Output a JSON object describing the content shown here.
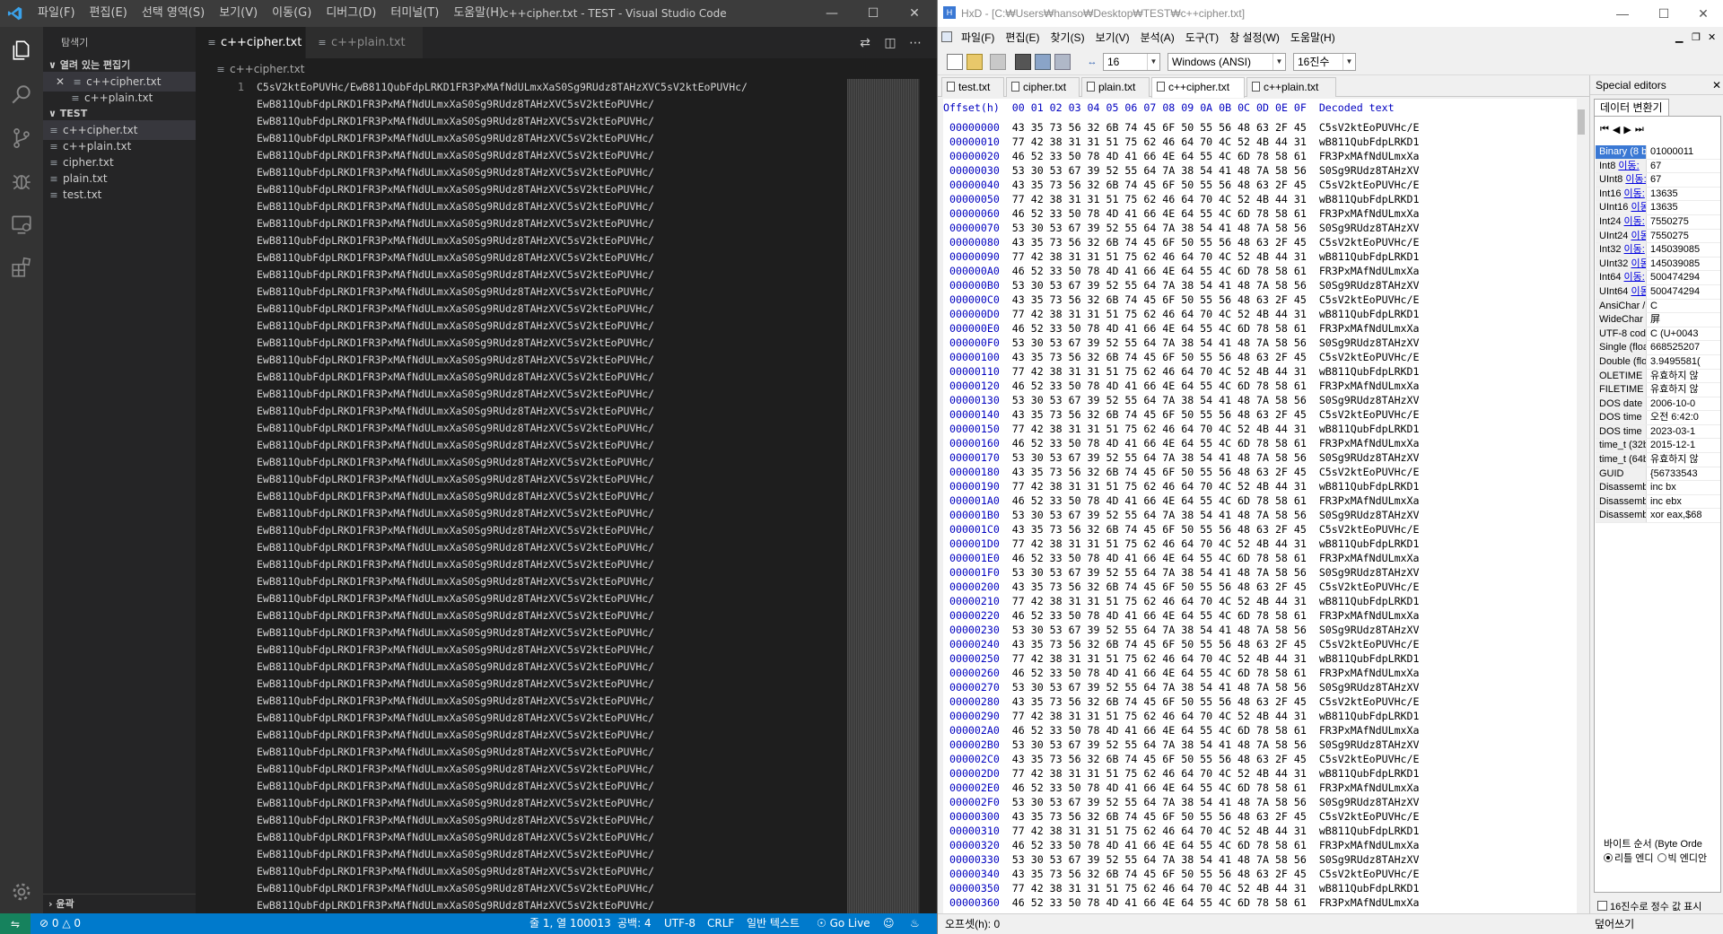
{
  "vscode": {
    "menu": [
      "파일(F)",
      "편집(E)",
      "선택 영역(S)",
      "보기(V)",
      "이동(G)",
      "디버그(D)",
      "터미널(T)",
      "도움말(H)"
    ],
    "window_title": "c++cipher.txt - TEST - Visual Studio Code",
    "sidebar": {
      "title": "탐색기",
      "open_editors_label": "열려 있는 편집기",
      "open_editors": [
        "c++cipher.txt",
        "c++plain.txt"
      ],
      "folder_label": "TEST",
      "files": [
        "c++cipher.txt",
        "c++plain.txt",
        "cipher.txt",
        "plain.txt",
        "test.txt"
      ],
      "outline_label": "윤곽"
    },
    "tabs": [
      {
        "label": "c++cipher.txt",
        "active": true
      },
      {
        "label": "c++plain.txt",
        "active": false
      }
    ],
    "breadcrumb": "c++cipher.txt",
    "editor": {
      "line_number": "1",
      "first_line": "C5sV2ktEoPUVHc/EwB811QubFdpLRKD1FR3PxMAfNdULmxXaS0Sg9RUdz8TAHzXVC5sV2ktEoPUVHc/",
      "wrap_line": "EwB811QubFdpLRKD1FR3PxMAfNdULmxXaS0Sg9RUdz8TAHzXVC5sV2ktEoPUVHc/"
    },
    "status": {
      "errors": "0",
      "warnings": "0",
      "position": "줄 1, 열 100013",
      "spaces": "공백: 4",
      "encoding": "UTF-8",
      "eol": "CRLF",
      "language": "일반 텍스트",
      "golive": "Go Live"
    }
  },
  "hxd": {
    "title": "HxD - [C:₩Users₩hanso₩Desktop₩TEST₩c++cipher.txt]",
    "menu": [
      "파일(F)",
      "편집(E)",
      "찾기(S)",
      "보기(V)",
      "분석(A)",
      "도구(T)",
      "창 설정(W)",
      "도움말(H)"
    ],
    "toolbar": {
      "bytes_per_row": "16",
      "charset": "Windows (ANSI)",
      "base": "16진수"
    },
    "tabs": [
      "test.txt",
      "cipher.txt",
      "plain.txt",
      "c++cipher.txt",
      "c++plain.txt"
    ],
    "active_tab": "c++cipher.txt",
    "header": {
      "offset": "Offset(h)",
      "columns": [
        "00",
        "01",
        "02",
        "03",
        "04",
        "05",
        "06",
        "07",
        "08",
        "09",
        "0A",
        "0B",
        "0C",
        "0D",
        "0E",
        "0F"
      ],
      "decoded": "Decoded text"
    },
    "pattern": [
      {
        "hex": "43 35 73 56 32 6B 74 45 6F 50 55 56 48 63 2F 45",
        "text": "C5sV2ktEoPUVHc/E"
      },
      {
        "hex": "77 42 38 31 31 51 75 62 46 64 70 4C 52 4B 44 31",
        "text": "wB811QubFdpLRKD1"
      },
      {
        "hex": "46 52 33 50 78 4D 41 66 4E 64 55 4C 6D 78 58 61",
        "text": "FR3PxMAfNdULmxXa"
      },
      {
        "hex": "53 30 53 67 39 52 55 64 7A 38 54 41 48 7A 58 56",
        "text": "S0Sg9RUdz8TAHzXV"
      }
    ],
    "offsets": [
      "00000000",
      "00000010",
      "00000020",
      "00000030",
      "00000040",
      "00000050",
      "00000060",
      "00000070",
      "00000080",
      "00000090",
      "000000A0",
      "000000B0",
      "000000C0",
      "000000D0",
      "000000E0",
      "000000F0",
      "00000100",
      "00000110",
      "00000120",
      "00000130",
      "00000140",
      "00000150",
      "00000160",
      "00000170",
      "00000180",
      "00000190",
      "000001A0",
      "000001B0",
      "000001C0",
      "000001D0",
      "000001E0",
      "000001F0",
      "00000200",
      "00000210",
      "00000220",
      "00000230",
      "00000240",
      "00000250",
      "00000260",
      "00000270",
      "00000280",
      "00000290",
      "000002A0",
      "000002B0",
      "000002C0",
      "000002D0",
      "000002E0",
      "000002F0",
      "00000300",
      "00000310",
      "00000320",
      "00000330",
      "00000340",
      "00000350",
      "00000360"
    ],
    "special": {
      "panel_title": "Special editors",
      "tab": "데이터 변환기",
      "rows": [
        {
          "label": "Binary (8 b",
          "link": "",
          "value": "01000011",
          "selected": true
        },
        {
          "label": "Int8 ",
          "link": "이동:",
          "value": "67"
        },
        {
          "label": "UInt8 ",
          "link": "이동:",
          "value": "67"
        },
        {
          "label": "Int16 ",
          "link": "이동:",
          "value": "13635"
        },
        {
          "label": "UInt16 ",
          "link": "이동:",
          "value": "13635"
        },
        {
          "label": "Int24 ",
          "link": "이동:",
          "value": "7550275"
        },
        {
          "label": "UInt24 ",
          "link": "이동:",
          "value": "7550275"
        },
        {
          "label": "Int32 ",
          "link": "이동:",
          "value": "145039085"
        },
        {
          "label": "UInt32 ",
          "link": "이동:",
          "value": "145039085"
        },
        {
          "label": "Int64 ",
          "link": "이동:",
          "value": "500474294"
        },
        {
          "label": "UInt64 ",
          "link": "이동:",
          "value": "500474294"
        },
        {
          "label": "AnsiChar / ",
          "link": "",
          "value": "C"
        },
        {
          "label": "WideChar / ",
          "link": "",
          "value": "屏"
        },
        {
          "label": "UTF-8 code",
          "link": "",
          "value": "C (U+0043"
        },
        {
          "label": "Single (floa",
          "link": "",
          "value": "668525207"
        },
        {
          "label": "Double (flo",
          "link": "",
          "value": "3.9495581("
        },
        {
          "label": "OLETIME",
          "link": "",
          "value": "유효하지 않"
        },
        {
          "label": "FILETIME",
          "link": "",
          "value": "유효하지 않"
        },
        {
          "label": "DOS date",
          "link": "",
          "value": "2006-10-0"
        },
        {
          "label": "DOS time",
          "link": "",
          "value": "오전 6:42:0"
        },
        {
          "label": "DOS time",
          "link": "",
          "value": "2023-03-1"
        },
        {
          "label": "time_t (32b",
          "link": "",
          "value": "2015-12-1"
        },
        {
          "label": "time_t (64b",
          "link": "",
          "value": "유효하지 않"
        },
        {
          "label": "GUID",
          "link": "",
          "value": "{56733543"
        },
        {
          "label": "Disassembl",
          "link": "",
          "value": "inc bx"
        },
        {
          "label": "Disassembl",
          "link": "",
          "value": "inc ebx"
        },
        {
          "label": "Disassembl",
          "link": "",
          "value": "xor eax,$68"
        }
      ],
      "byte_order_label": "바이트 순서 (Byte Orde",
      "little_endian": "리틀 엔디",
      "big_endian": "빅 엔디안",
      "hex_check": "16진수로 정수 값 표시"
    },
    "status": {
      "offset": "오프셋(h): 0",
      "mode": "덮어쓰기"
    }
  }
}
